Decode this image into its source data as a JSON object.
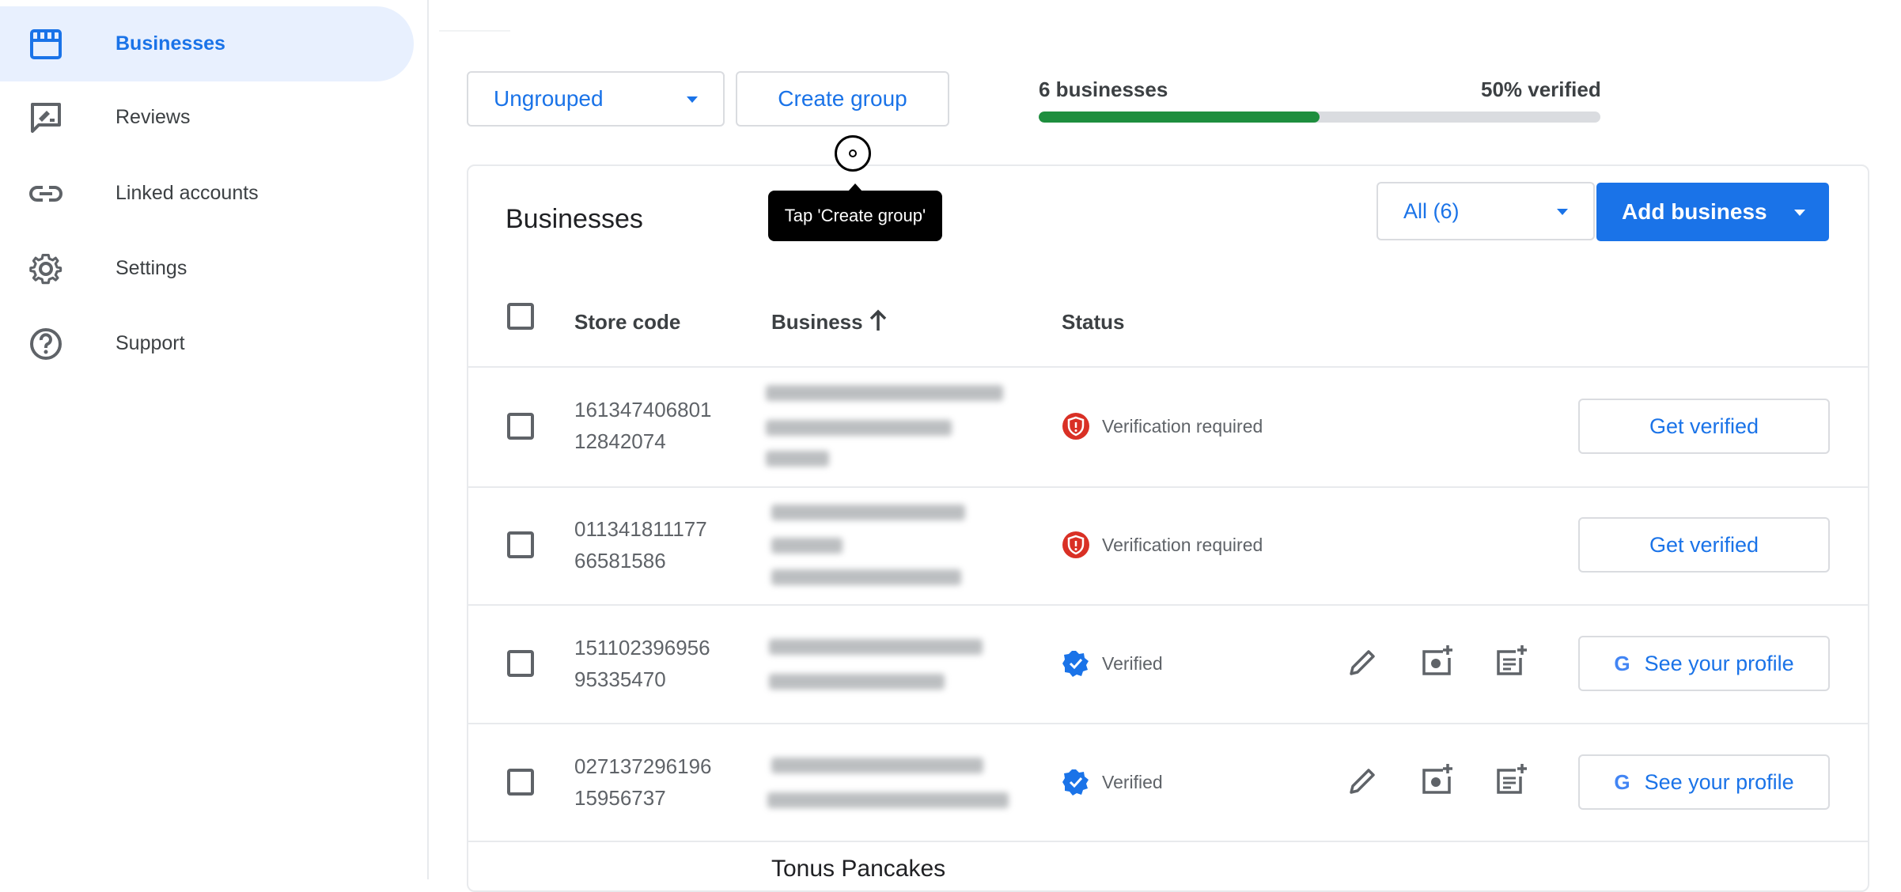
{
  "sidebar": {
    "items": [
      {
        "label": "Businesses",
        "icon": "storefront-icon",
        "active": true
      },
      {
        "label": "Reviews",
        "icon": "review-icon"
      },
      {
        "label": "Linked accounts",
        "icon": "link-icon"
      },
      {
        "label": "Settings",
        "icon": "gear-icon"
      },
      {
        "label": "Support",
        "icon": "help-icon"
      }
    ]
  },
  "toolbar": {
    "group_select": "Ungrouped",
    "create_group": "Create group"
  },
  "summary": {
    "count_label": "6 businesses",
    "verified_label": "50% verified",
    "verified_fraction": 0.5
  },
  "tooltip": "Tap 'Create group'",
  "card": {
    "title": "Businesses",
    "filter": "All (6)",
    "add_business": "Add business"
  },
  "columns": {
    "store_code": "Store code",
    "business": "Business",
    "status": "Status"
  },
  "rows": [
    {
      "store_code_1": "161347406801",
      "store_code_2": "12842074",
      "status": "Verification required",
      "action": "Get verified"
    },
    {
      "store_code_1": "011341811177",
      "store_code_2": "66581586",
      "status": "Verification required",
      "action": "Get verified"
    },
    {
      "store_code_1": "151102396956",
      "store_code_2": "95335470",
      "status": "Verified",
      "action": "See your profile"
    },
    {
      "store_code_1": "027137296196",
      "store_code_2": "15956737",
      "status": "Verified",
      "action": "See your profile"
    },
    {
      "business_name": "Tonus Pancakes"
    }
  ],
  "colors": {
    "accent": "#1a73e8",
    "progress": "#1e8e3e",
    "warning": "#d93025"
  }
}
